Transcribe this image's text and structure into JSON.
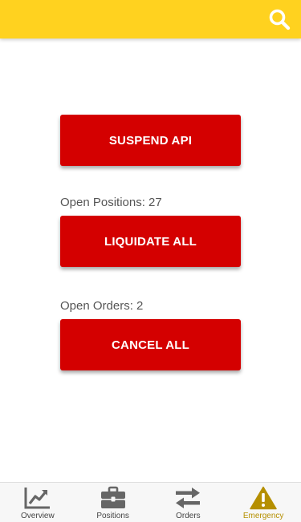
{
  "header": {
    "search_icon": "search-icon",
    "bar_color": "#ffd21f"
  },
  "actions": {
    "suspend_api_label": "SUSPEND API",
    "open_positions_text": "Open Positions: 27",
    "liquidate_all_label": "LIQUIDATE ALL",
    "open_orders_text": "Open Orders: 2",
    "cancel_all_label": "CANCEL ALL",
    "button_color": "#d40000"
  },
  "bottom_nav": {
    "items": [
      {
        "label": "Overview",
        "icon": "chart-line-icon"
      },
      {
        "label": "Positions",
        "icon": "briefcase-icon"
      },
      {
        "label": "Orders",
        "icon": "exchange-arrows-icon"
      },
      {
        "label": "Emergency",
        "icon": "warning-icon",
        "active": true
      }
    ],
    "active_color": "#b58f00"
  }
}
